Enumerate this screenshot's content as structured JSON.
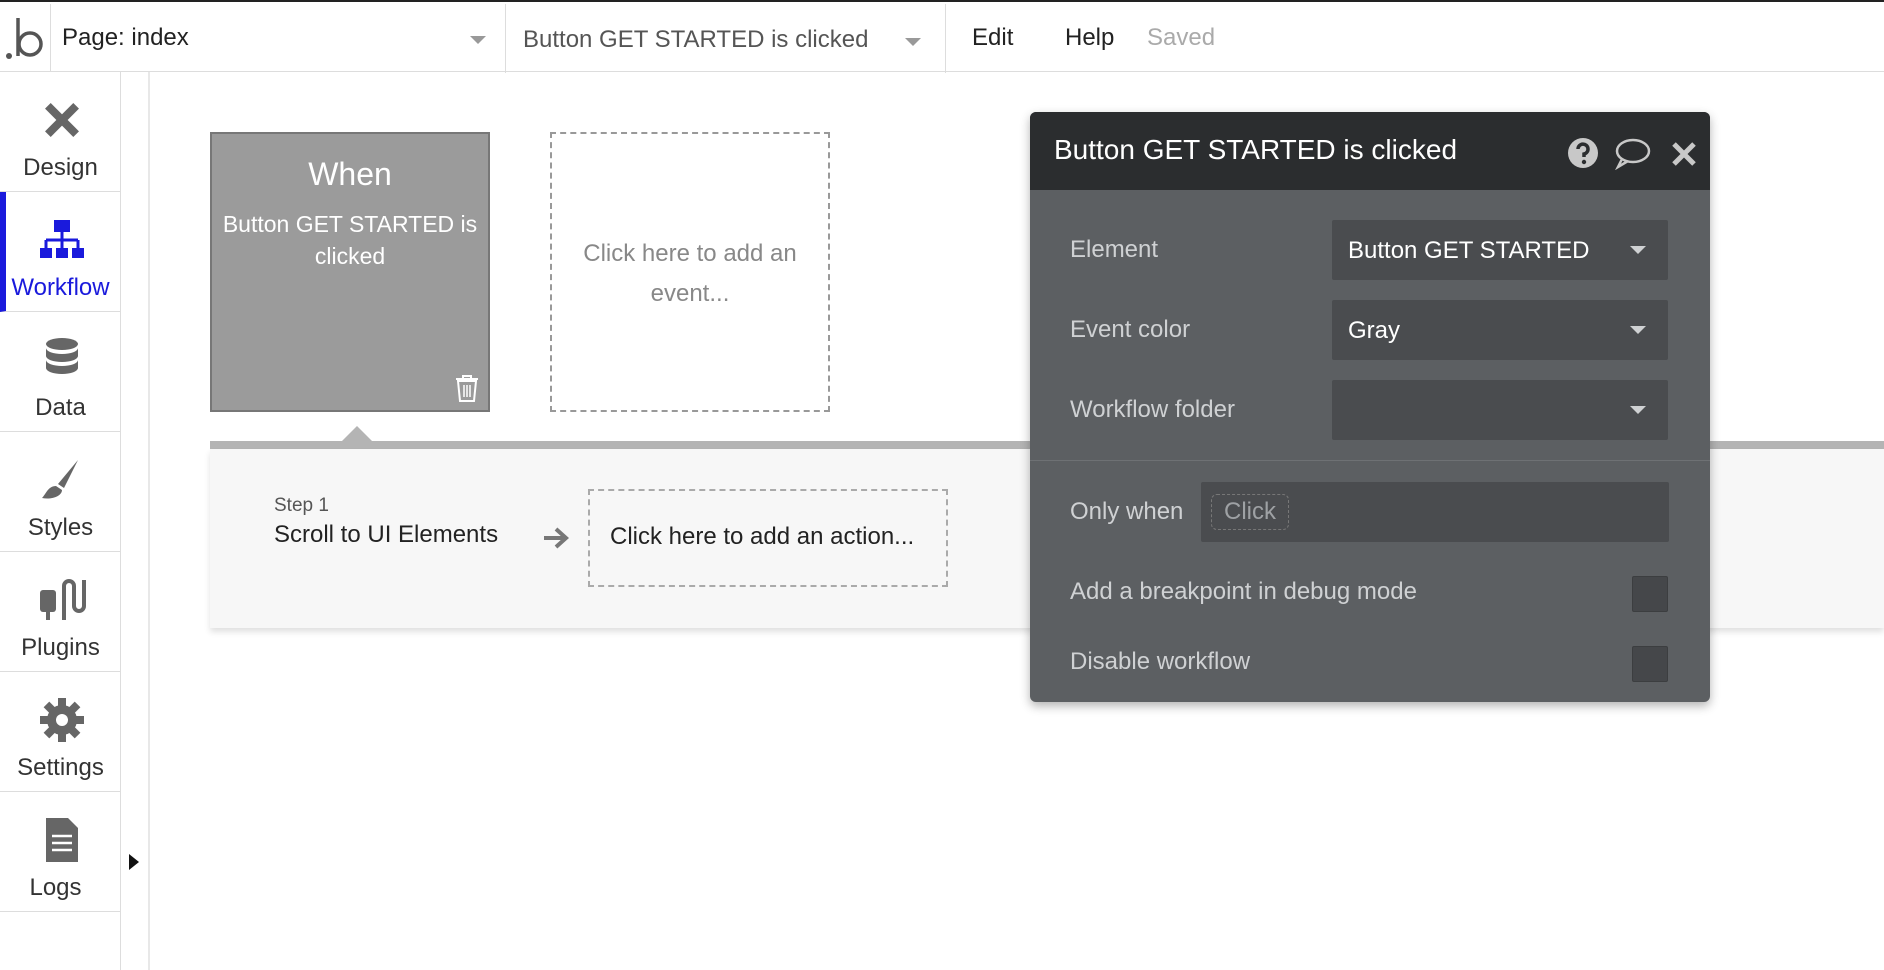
{
  "topbar": {
    "page_select_label": "Page: index",
    "workflow_select_label": "Button GET STARTED is clicked",
    "menu_edit": "Edit",
    "menu_help": "Help",
    "save_status": "Saved"
  },
  "sidebar": {
    "items": [
      {
        "label": "Design",
        "icon": "design-icon"
      },
      {
        "label": "Workflow",
        "icon": "workflow-icon",
        "active": true
      },
      {
        "label": "Data",
        "icon": "database-icon"
      },
      {
        "label": "Styles",
        "icon": "brush-icon"
      },
      {
        "label": "Plugins",
        "icon": "plug-icon"
      },
      {
        "label": "Settings",
        "icon": "gear-icon"
      },
      {
        "label": "Logs",
        "icon": "document-icon"
      }
    ]
  },
  "canvas": {
    "event_card": {
      "title": "When",
      "description": "Button GET STARTED is clicked"
    },
    "add_event_text": "Click here to add an event...",
    "step": {
      "label": "Step 1",
      "action": "Scroll to UI Elements"
    },
    "add_action_text": "Click here to add an action..."
  },
  "panel": {
    "title": "Button GET STARTED is clicked",
    "element_label": "Element",
    "element_value": "Button GET STARTED",
    "event_color_label": "Event color",
    "event_color_value": "Gray",
    "folder_label": "Workflow folder",
    "folder_value": "",
    "only_when_label": "Only when",
    "only_when_placeholder": "Click",
    "breakpoint_label": "Add a breakpoint in debug mode",
    "disable_label": "Disable workflow"
  },
  "colors": {
    "accent": "#1a1adc",
    "event_card": "#9b9b9b",
    "panel_bg": "#5c5f62",
    "panel_header": "#2b2d2f"
  }
}
